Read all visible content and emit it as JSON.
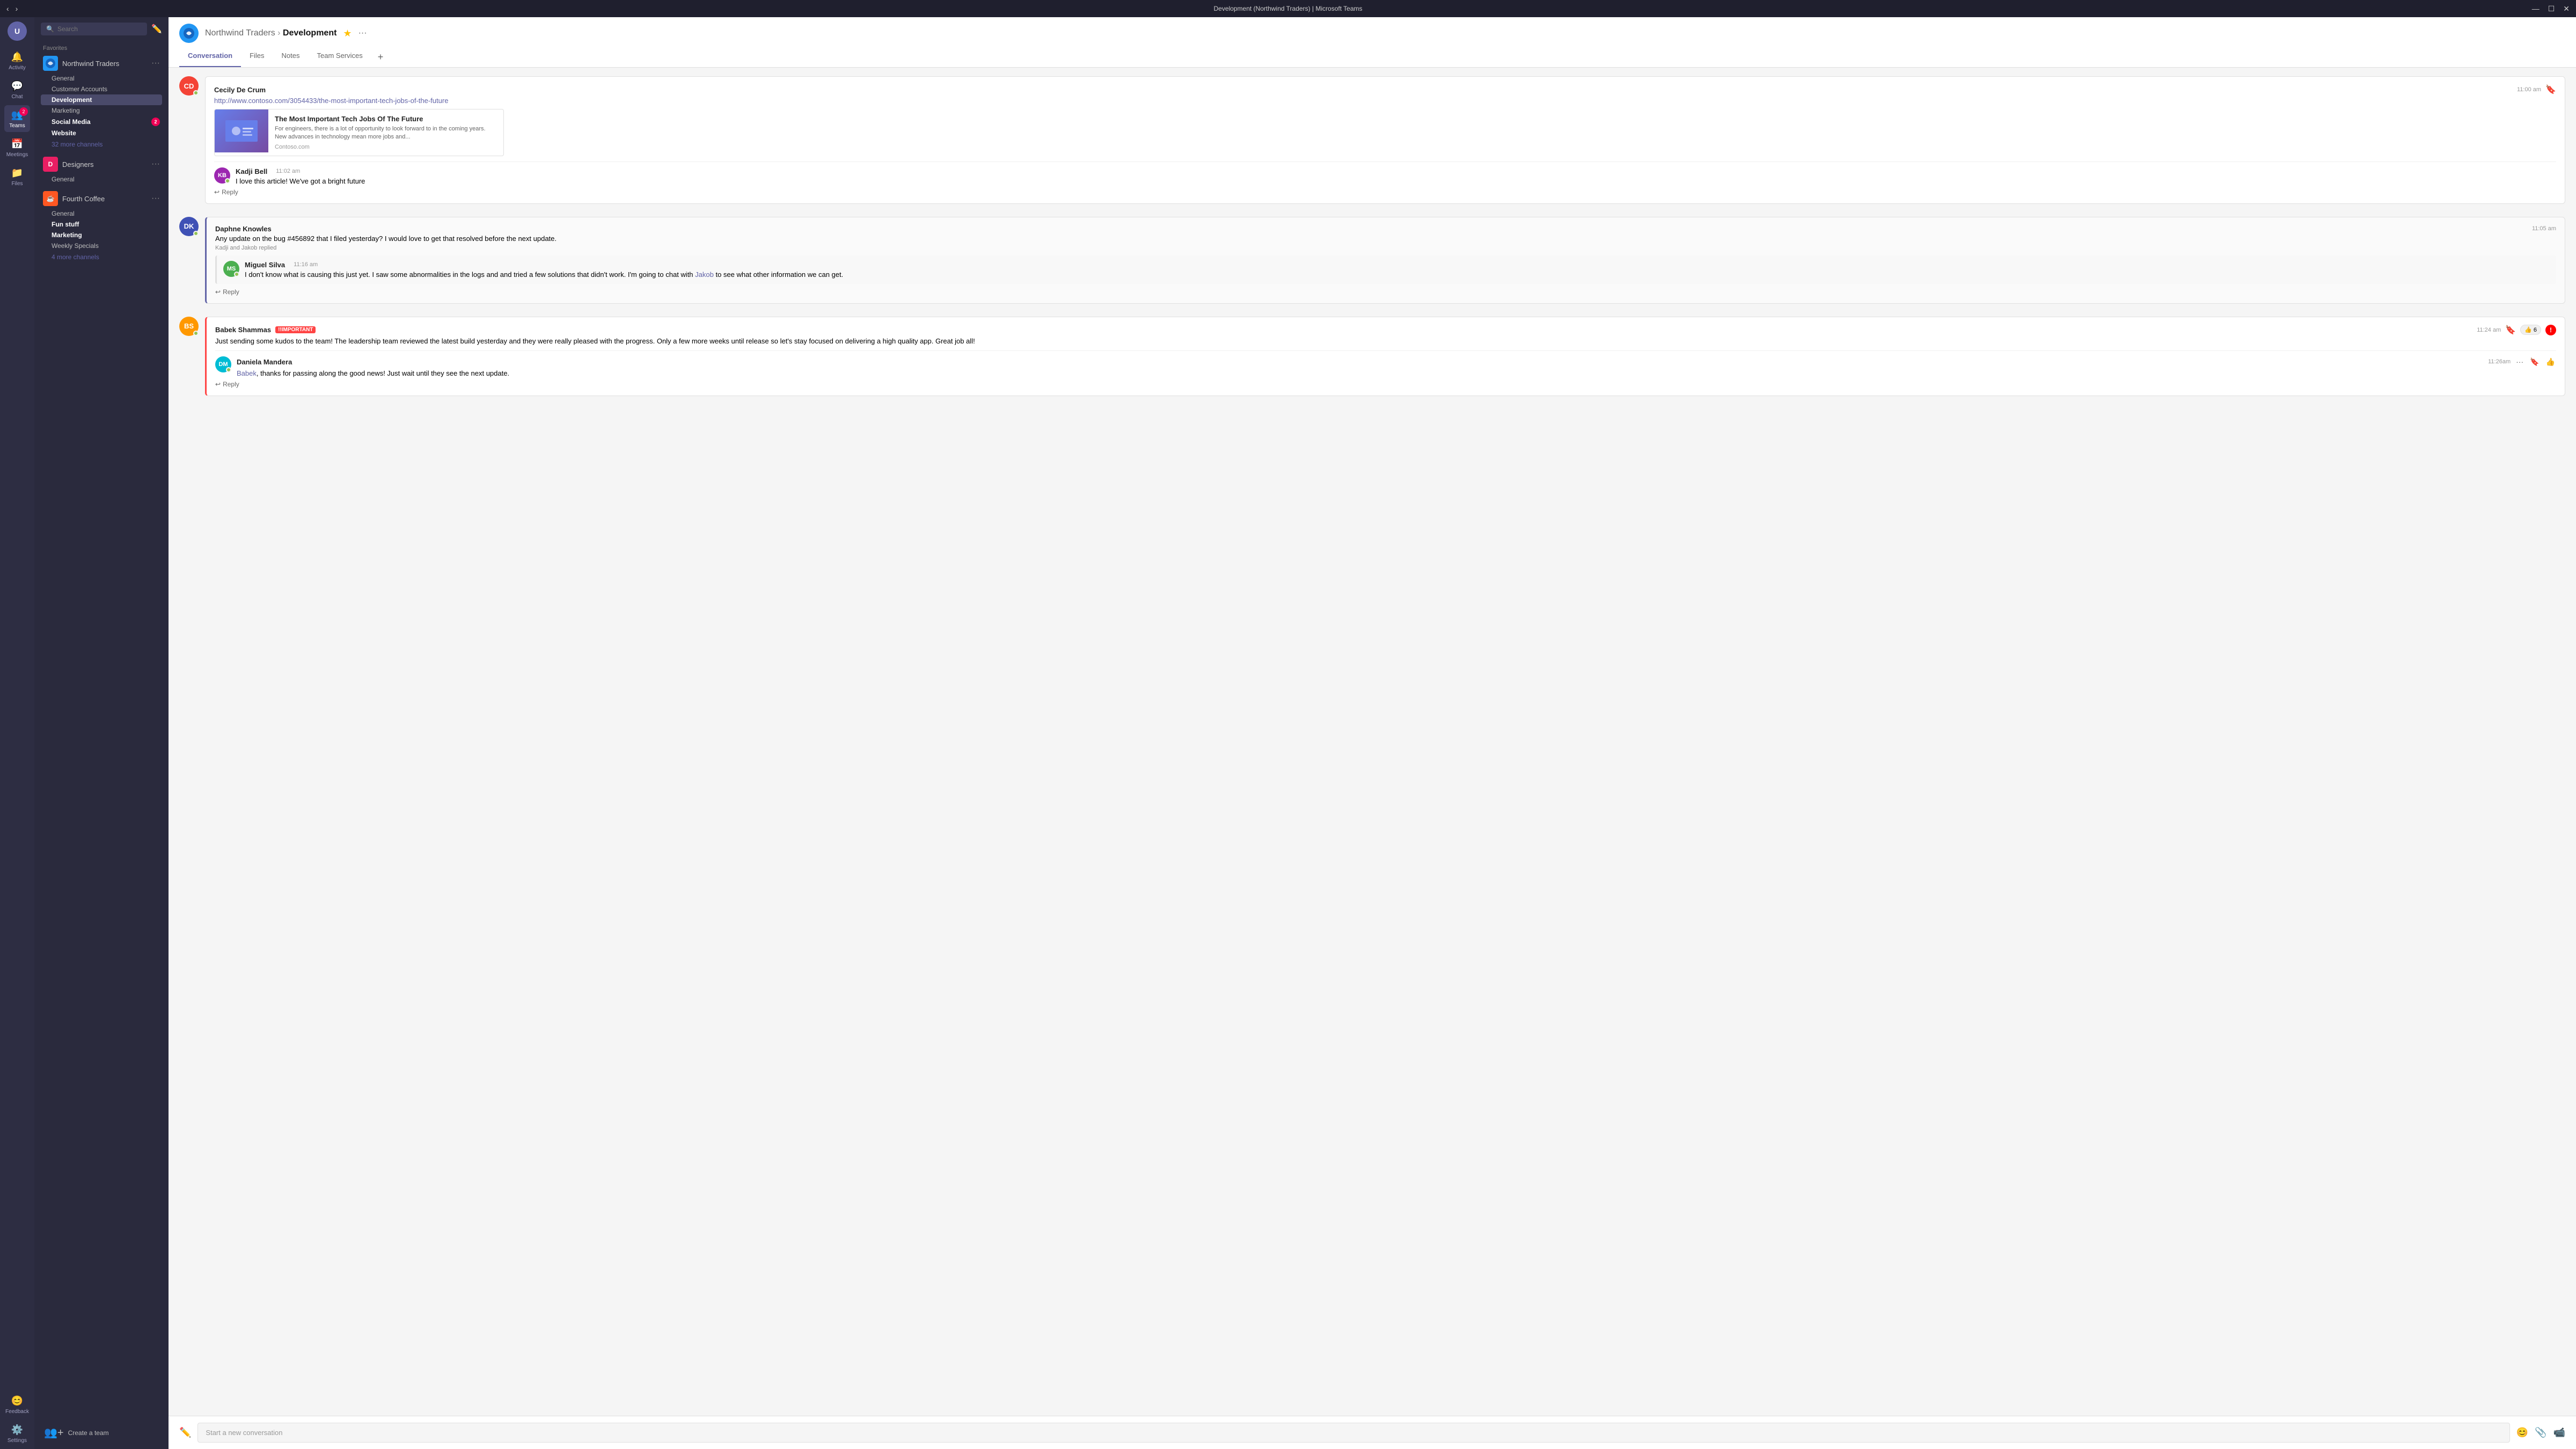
{
  "titlebar": {
    "title": "Development (Northwind Traders) | Microsoft Teams",
    "controls": [
      "—",
      "☐",
      "✕"
    ]
  },
  "rail": {
    "user_initial": "U",
    "items": [
      {
        "id": "activity",
        "label": "Activity",
        "icon": "🔔",
        "active": false
      },
      {
        "id": "chat",
        "label": "Chat",
        "icon": "💬",
        "active": false
      },
      {
        "id": "teams",
        "label": "Teams",
        "icon": "👥",
        "active": true,
        "badge": "2"
      },
      {
        "id": "meetings",
        "label": "Meetings",
        "icon": "📅",
        "active": false
      },
      {
        "id": "files",
        "label": "Files",
        "icon": "📁",
        "active": false
      }
    ],
    "bottom": [
      {
        "id": "feedback",
        "label": "Feedback",
        "icon": "😊"
      },
      {
        "id": "settings",
        "label": "Settings",
        "icon": "⚙️"
      }
    ]
  },
  "sidebar": {
    "search_placeholder": "Search",
    "favorites_label": "Favorites",
    "teams": [
      {
        "name": "Northwind Traders",
        "avatar_bg": "#2196f3",
        "avatar_text": "NT",
        "channels": [
          {
            "name": "General",
            "active": false,
            "bold": false
          },
          {
            "name": "Customer Accounts",
            "active": false,
            "bold": false
          },
          {
            "name": "Development",
            "active": true,
            "bold": false
          },
          {
            "name": "Marketing",
            "active": false,
            "bold": false
          },
          {
            "name": "Social Media",
            "active": false,
            "bold": true,
            "badge": "2"
          },
          {
            "name": "Website",
            "active": false,
            "bold": true
          }
        ],
        "more_channels": "32 more channels"
      },
      {
        "name": "Designers",
        "avatar_bg": "#e91e63",
        "avatar_text": "D",
        "channels": [
          {
            "name": "General",
            "active": false,
            "bold": false
          }
        ]
      },
      {
        "name": "Fourth Coffee",
        "avatar_bg": "#ff5722",
        "avatar_text": "FC",
        "channels": [
          {
            "name": "General",
            "active": false,
            "bold": false
          },
          {
            "name": "Fun stuff",
            "active": false,
            "bold": true
          },
          {
            "name": "Marketing",
            "active": false,
            "bold": true
          },
          {
            "name": "Weekly Specials",
            "active": false,
            "bold": false
          }
        ],
        "more_channels": "4 more channels"
      }
    ],
    "create_team": "Create a team"
  },
  "header": {
    "team_name": "Northwind Traders",
    "channel_name": "Development",
    "tabs": [
      "Conversation",
      "Files",
      "Notes",
      "Team Services"
    ],
    "active_tab": "Conversation",
    "add_tab": "+"
  },
  "messages": [
    {
      "id": "msg1",
      "author": "Cecily De Crum",
      "avatar_bg": "#f44336",
      "avatar_text": "CD",
      "online": true,
      "time": "11:00 am",
      "link_url": "http://www.contoso.com/3054433/the-most-important-tech-jobs-of-the-future",
      "link_card": {
        "title": "The Most Important Tech Jobs Of The Future",
        "description": "For engineers, there is a lot of opportunity to look forward to in the coming years. New advances in technology mean more jobs and...",
        "source": "Contoso.com"
      },
      "reply": {
        "author": "Kadji Bell",
        "avatar_bg": "#9c27b0",
        "avatar_text": "KB",
        "online": true,
        "text": "I love this article! We've got a bright future",
        "time": "11:02 am"
      },
      "reply_label": "Reply",
      "bookmarked": true
    },
    {
      "id": "msg2",
      "author": "Daphne Knowles",
      "avatar_bg": "#3f51b5",
      "avatar_text": "DK",
      "online": true,
      "time": "11:05 am",
      "text": "Any update on the bug #456892 that I filed yesterday? I would love to get that resolved before the next update.",
      "thread_reply": "Kadji and Jakob replied",
      "nested": {
        "author": "Miguel Silva",
        "avatar_bg": "#4caf50",
        "avatar_text": "MS",
        "online": true,
        "time": "11:16 am",
        "text_before": "I don't know what is causing this just yet. I saw some abnormalities in the logs and and tried a few solutions that didn't work. I'm going to chat with ",
        "mention": "Jakob",
        "text_after": " to see what other information we can get."
      },
      "reply_label": "Reply"
    },
    {
      "id": "msg3",
      "author": "Babek Shammas",
      "avatar_bg": "#ff9800",
      "avatar_text": "BS",
      "online": true,
      "time": "11:24 am",
      "important": "!!IMPORTANT",
      "text": "Just sending some kudos to the team! The leadership team reviewed the latest build yesterday and they were really pleased with the progress. Only a few more weeks until release so let's stay focused on delivering a high quality app. Great job all!",
      "reply": {
        "author": "Daniela Mandera",
        "avatar_bg": "#00bcd4",
        "avatar_text": "DM",
        "online": true,
        "time": "11:26am",
        "mention": "Babek",
        "text_after": ", thanks for passing along the good news! Just wait until they see the next update."
      },
      "reactions": [
        {
          "emoji": "👍",
          "count": "6"
        }
      ],
      "bookmarked": true,
      "reply_label": "Reply"
    }
  ],
  "compose": {
    "placeholder": "Start a new conversation"
  }
}
